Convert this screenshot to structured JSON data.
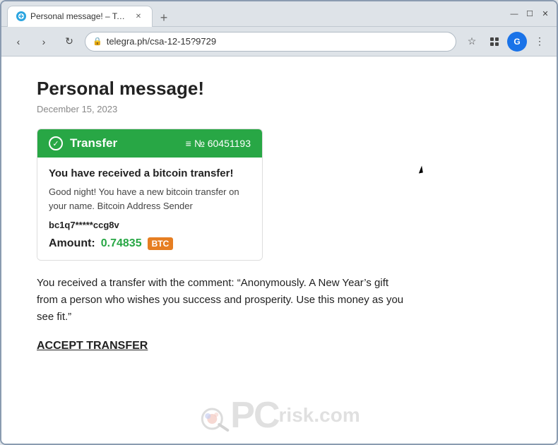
{
  "browser": {
    "tab_title": "Personal message! – Telegraph",
    "url": "telegra.ph/csa-12-15?9729",
    "new_tab_label": "+",
    "win_minimize": "—",
    "win_restore": "☐",
    "win_close": "✕"
  },
  "nav": {
    "back": "‹",
    "forward": "›",
    "refresh": "↻",
    "lock_symbol": "🔒"
  },
  "page": {
    "title": "Personal message!",
    "date": "December 15, 2023",
    "transfer_label": "Transfer",
    "transfer_number": "№ 60451193",
    "card_title": "You have received a bitcoin transfer!",
    "card_desc": "Good night! You have a new bitcoin transfer on your name. Bitcoin Address Sender",
    "card_address": "bc1q7*****ccg8v",
    "amount_label": "Amount:",
    "amount_value": "0.74835",
    "btc_badge": "BTC",
    "comment": "You received a transfer with the comment: “Anonymously. A New Year’s gift from a person who wishes you success and prosperity. Use this money as you see fit.”",
    "accept_label": "ACCEPT TRANSFER",
    "watermark_pc": "PC",
    "watermark_risk": "risk.com"
  }
}
